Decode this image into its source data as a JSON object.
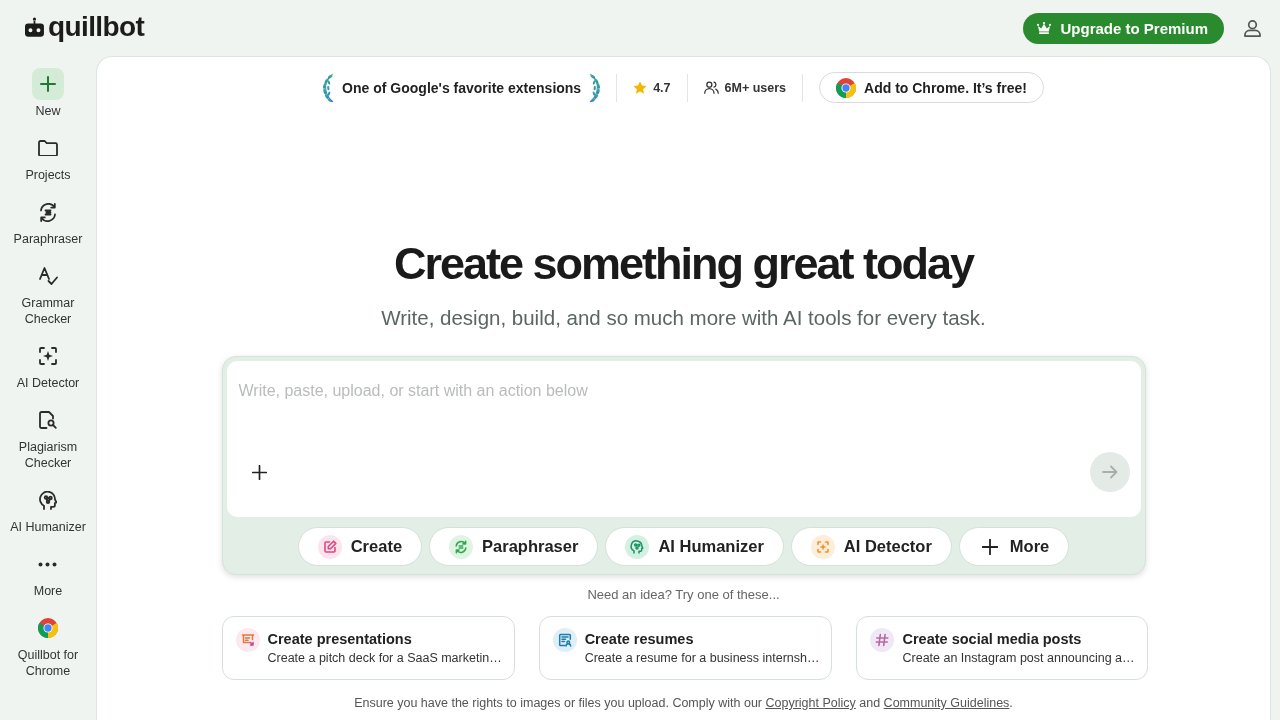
{
  "header": {
    "logo_text": "quillbot",
    "upgrade_button": "Upgrade to Premium"
  },
  "sidebar": {
    "items": [
      {
        "label": "New"
      },
      {
        "label": "Projects"
      },
      {
        "label": "Paraphraser"
      },
      {
        "label": "Grammar Checker"
      },
      {
        "label": "AI Detector"
      },
      {
        "label": "Plagiarism Checker"
      },
      {
        "label": "AI Humanizer"
      },
      {
        "label": "More"
      },
      {
        "label": "Quillbot for Chrome"
      }
    ]
  },
  "banner": {
    "award": "One of Google's favorite extensions",
    "rating": "4.7",
    "users": "6M+ users",
    "cta_button": "Add to Chrome. It’s free!"
  },
  "hero": {
    "title": "Create something great today",
    "subtitle": "Write, design, build, and so much more with AI tools for every task."
  },
  "composer": {
    "placeholder": "Write, paste, upload, or start with an action below",
    "actions": [
      {
        "label": "Create"
      },
      {
        "label": "Paraphraser"
      },
      {
        "label": "AI Humanizer"
      },
      {
        "label": "AI Detector"
      },
      {
        "label": "More"
      }
    ]
  },
  "ideas": {
    "prompt": "Need an idea? Try one of these...",
    "cards": [
      {
        "title": "Create presentations",
        "description": "Create a pitch deck for a SaaS marketin…"
      },
      {
        "title": "Create resumes",
        "description": "Create a resume for a business internsh…"
      },
      {
        "title": "Create social media posts",
        "description": "Create an Instagram post announcing a…"
      }
    ]
  },
  "notice": {
    "text": "Ensure you have the rights to images or files you upload. Comply with our",
    "links": [
      "Copyright Policy",
      "Community Guidelines"
    ],
    "conjunction": "and",
    "end": "."
  }
}
